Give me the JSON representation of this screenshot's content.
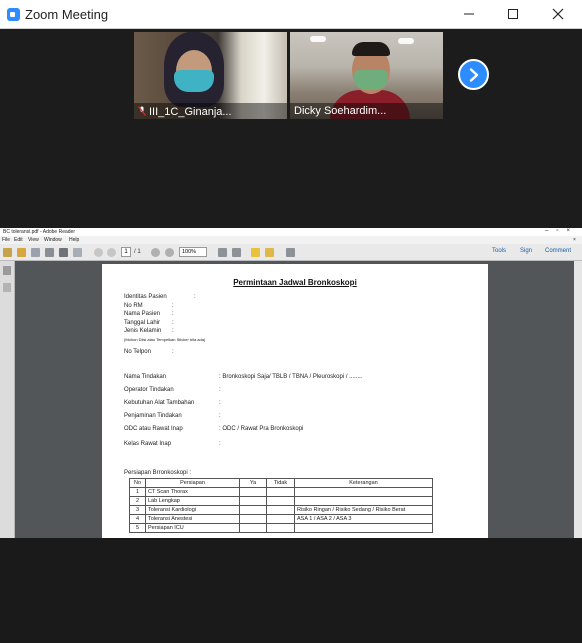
{
  "zoom": {
    "title": "Zoom Meeting",
    "participants": [
      {
        "name": "III_1C_Ginanja...",
        "muted": true
      },
      {
        "name": "Dicky Soehardim...",
        "muted": false
      }
    ]
  },
  "reader": {
    "window_title": "BC toleransi.pdf - Adobe Reader",
    "menu": [
      "File",
      "Edit",
      "View",
      "Window",
      "Help"
    ],
    "page_current": "1",
    "page_total": "/ 1",
    "zoom_level": "100%",
    "right_tools": [
      "Tools",
      "Sign",
      "Comment"
    ]
  },
  "document": {
    "title": "Permintaan Jadwal Bronkoskopi",
    "identity_label": "Identitas Pasien",
    "no_rm": "No RM",
    "nama_pasien": "Nama Pasien",
    "tanggal_lahir": "Tanggal Lahir",
    "jenis_kelamin": "Jenis Kelamin",
    "sticker_note": "(Mohon Diisi atau Tempelkan Sticker bila ada)",
    "no_telpon": "No Telpon",
    "nama_tindakan": "Nama Tindakan",
    "nama_tindakan_value": ": Bronkoskopi Saja/ TBLB / TBNA / Pleuroskopi / ........",
    "operator_tindakan": "Operator Tindakan",
    "kebutuhan_alat": "Kebutuhan Alat Tambahan",
    "penjaminan": "Penjaminan Tindakan",
    "odc_label": "ODC atau Rawat Inap",
    "odc_value": ": ODC  /  Rawat Pra Bronkoskopi",
    "kelas_rawat": "Kelas Rawat Inap",
    "persiapan_heading": "Persiapan Brronkoskopi :",
    "table": {
      "headers": [
        "No",
        "Persiapan",
        "Ya",
        "Tidak",
        "Keterangan"
      ],
      "rows": [
        [
          "1",
          "CT Scan Thorax",
          "",
          "",
          ""
        ],
        [
          "2",
          "Lab Lengkap",
          "",
          "",
          ""
        ],
        [
          "3",
          "Toleransi Kardiologi",
          "",
          "",
          "Risiko Ringan / Risiko Sedang / Risiko Berat"
        ],
        [
          "4",
          "Toleransi Anestesi",
          "",
          "",
          "ASA 1 / ASA 2 / ASA 3"
        ],
        [
          "5",
          "Persiapan ICU",
          "",
          "",
          ""
        ]
      ]
    }
  },
  "colors": {
    "zoom_blue": "#2d8cff",
    "reader_bg": "#525659",
    "link_blue": "#1a5fa6"
  }
}
